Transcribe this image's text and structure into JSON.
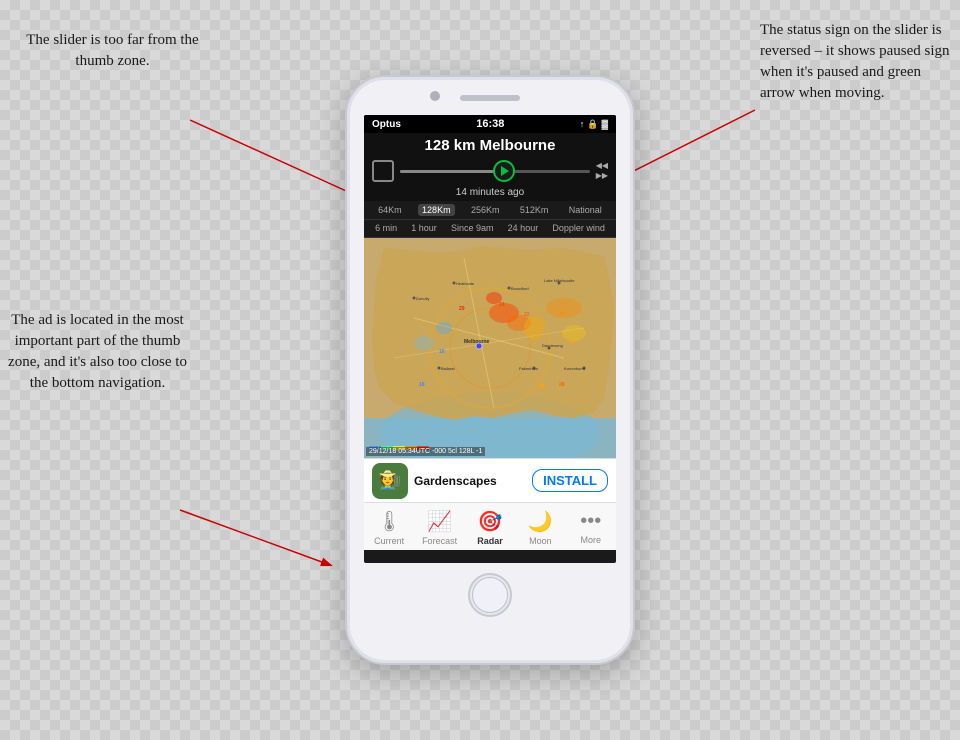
{
  "annotations": {
    "top_left": "The slider is too far from the thumb zone.",
    "top_right": "The status sign on the slider is reversed – it shows paused sign when it's paused and green arrow when moving.",
    "mid_left": "The ad is located in the most important part of the thumb zone, and it's also too close to the bottom navigation."
  },
  "phone": {
    "status_bar": {
      "carrier": "Optus",
      "wifi": "wifi",
      "time": "16:38",
      "location": "↑",
      "battery": "battery"
    },
    "header": {
      "title": "128 km Melbourne"
    },
    "slider": {
      "time_ago": "14 minutes ago",
      "square_btn": "□"
    },
    "range_tabs": [
      {
        "label": "64Km",
        "active": false
      },
      {
        "label": "128Km",
        "active": true
      },
      {
        "label": "256Km",
        "active": false
      },
      {
        "label": "512Km",
        "active": false
      },
      {
        "label": "National",
        "active": false
      }
    ],
    "time_tabs": [
      {
        "label": "6 min",
        "active": false
      },
      {
        "label": "1 hour",
        "active": false
      },
      {
        "label": "Since 9am",
        "active": false
      },
      {
        "label": "24 hour",
        "active": false
      },
      {
        "label": "Doppler wind",
        "active": false
      }
    ],
    "ad": {
      "icon_emoji": "🧑‍🌾",
      "title": "Gardenscapes",
      "install_label": "INSTALL"
    },
    "nav_items": [
      {
        "label": "Current",
        "icon": "🌡",
        "active": false
      },
      {
        "label": "Forecast",
        "icon": "📈",
        "active": false
      },
      {
        "label": "Radar",
        "icon": "🎯",
        "active": true
      },
      {
        "label": "Moon",
        "icon": "🌙",
        "active": false
      },
      {
        "label": "More",
        "icon": "•••",
        "active": false
      }
    ],
    "map_timestamp": "29/12/18 05:34UTC -000 5cl  128L -1"
  }
}
